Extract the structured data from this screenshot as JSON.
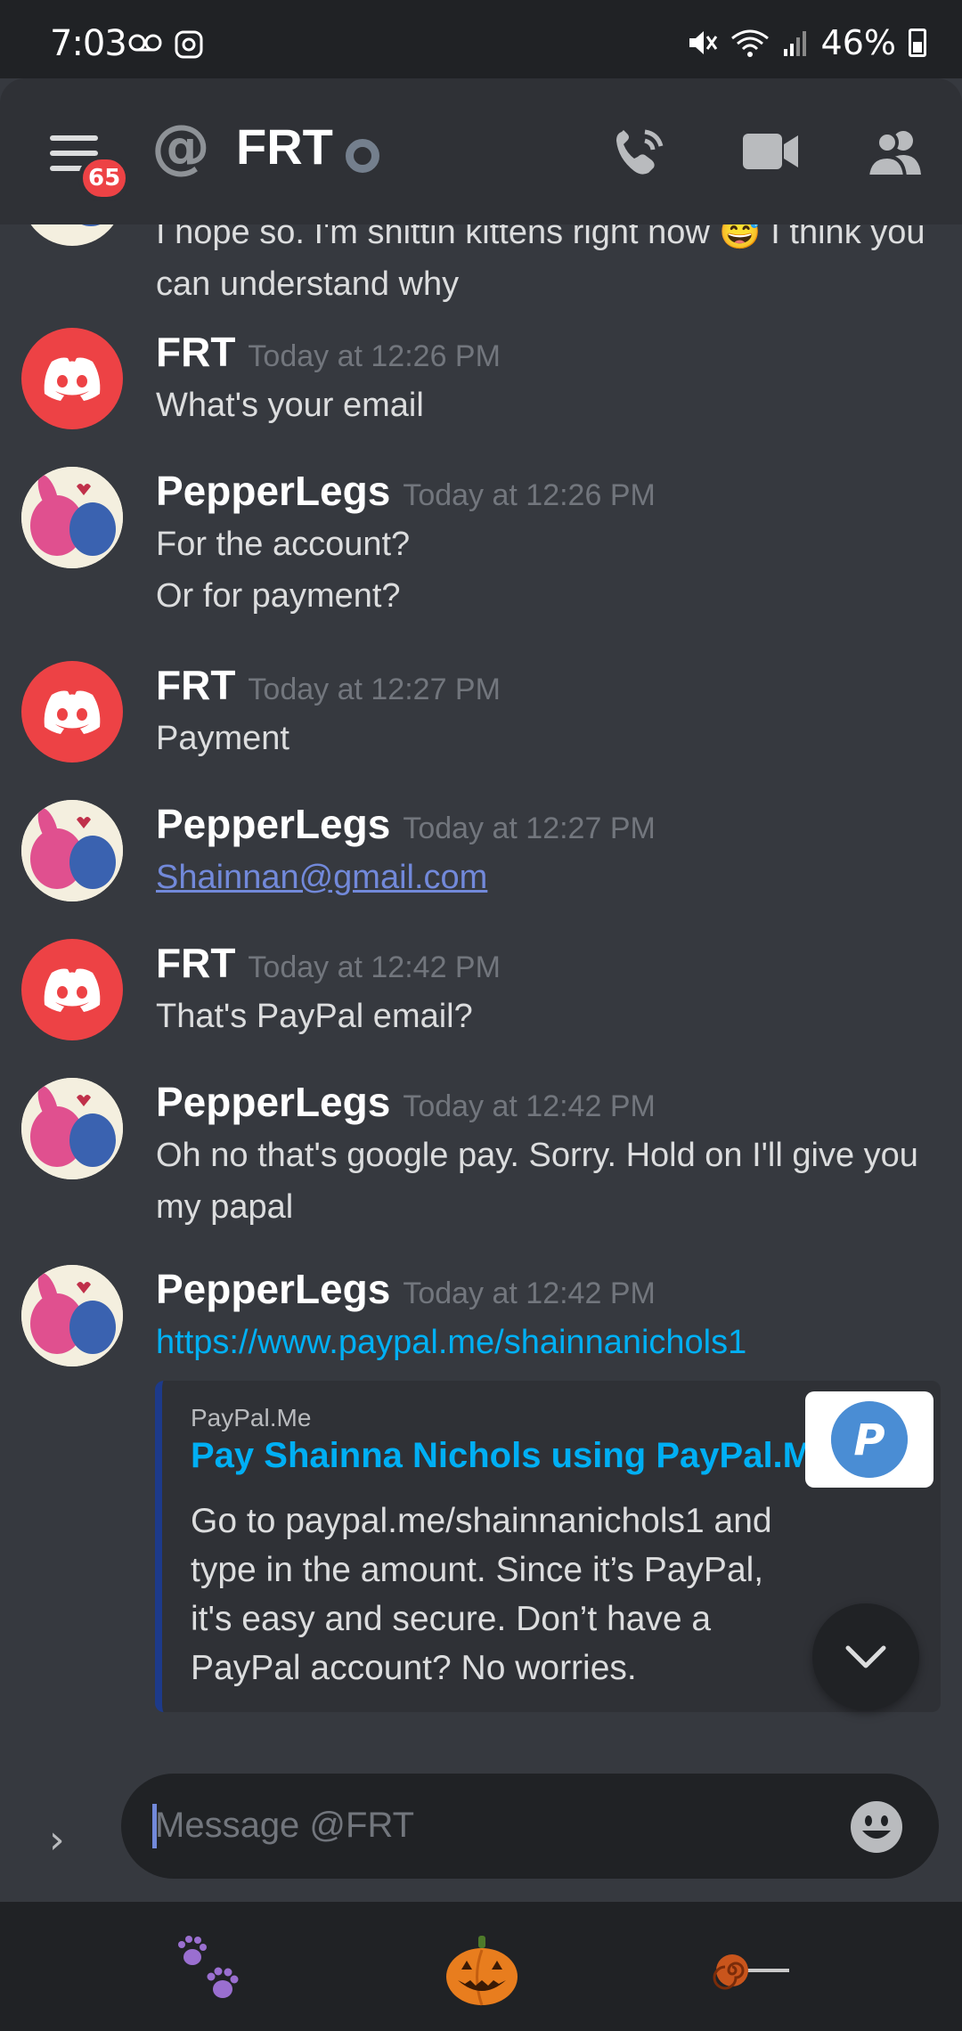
{
  "status_bar": {
    "time": "7:03",
    "battery": "46%"
  },
  "header": {
    "badge_count": "65",
    "at_symbol": "@",
    "channel_name": "FRT"
  },
  "messages": [
    {
      "type": "continuation",
      "text": "I hope so. I'm shittin kittens right now 😅 I think you can understand why"
    },
    {
      "author": "FRT",
      "timestamp": "Today at 12:26 PM",
      "lines": [
        "What's your email"
      ],
      "avatar": "discord-logo-icon"
    },
    {
      "author": "PepperLegs",
      "timestamp": "Today at 12:26 PM",
      "lines": [
        "For the account?",
        "Or for payment?"
      ],
      "avatar": "stitch-angel-avatar"
    },
    {
      "author": "FRT",
      "timestamp": "Today at 12:27 PM",
      "lines": [
        "Payment"
      ],
      "avatar": "discord-logo-icon"
    },
    {
      "author": "PepperLegs",
      "timestamp": "Today at 12:27 PM",
      "link": "Shainnan@gmail.com",
      "avatar": "stitch-angel-avatar"
    },
    {
      "author": "FRT",
      "timestamp": "Today at 12:42 PM",
      "lines": [
        "That's PayPal email?"
      ],
      "avatar": "discord-logo-icon"
    },
    {
      "author": "PepperLegs",
      "timestamp": "Today at 12:42 PM",
      "text": "Oh no that's google pay. Sorry. Hold on I'll give you my papal",
      "avatar": "stitch-angel-avatar"
    },
    {
      "author": "PepperLegs",
      "timestamp": "Today at 12:42 PM",
      "link": "https://www.paypal.me/shainnanichols1",
      "avatar": "stitch-angel-avatar"
    }
  ],
  "embed": {
    "provider": "PayPal.Me",
    "title": "Pay Shainna Nichols using PayPal.Me",
    "description": "Go to paypal.me/shainnanichols1 and type in the amount. Since it’s PayPal, it's easy and secure. Don’t have a PayPal account? No worries.",
    "thumbnail": "paypal-logo-icon"
  },
  "composer": {
    "placeholder": "Message @FRT",
    "expand": "›"
  },
  "colors": {
    "accent": "#7289da",
    "link": "#00aff4",
    "danger": "#ed4245",
    "background": "#36393f",
    "header": "#2f3136"
  },
  "bottom_bar": {
    "items": [
      "paw-prints-icon",
      "jack-o-lantern-icon",
      "lollipop-icon"
    ]
  }
}
